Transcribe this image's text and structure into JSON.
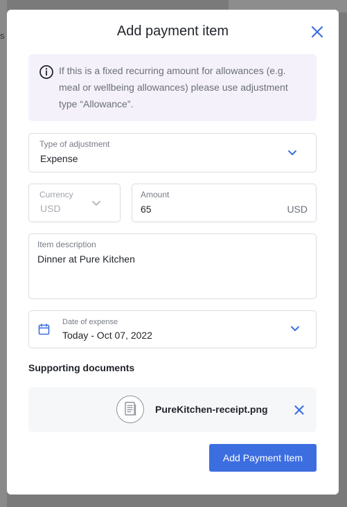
{
  "backdrop": {
    "fragment": "s l"
  },
  "modal": {
    "title": "Add payment item",
    "info": {
      "icon": "info-circle-icon",
      "text": "If this is a fixed recurring amount for allowances (e.g. meal or wellbeing allowances) please use adjustment type “Allowance”."
    },
    "type_of_adjustment": {
      "label": "Type of adjustment",
      "value": "Expense"
    },
    "currency": {
      "label": "Currency",
      "value": "USD"
    },
    "amount": {
      "label": "Amount",
      "value": "65",
      "unit": "USD"
    },
    "item_description": {
      "label": "Item description",
      "value": "Dinner at Pure Kitchen"
    },
    "date_of_expense": {
      "label": "Date of expense",
      "value": "Today - Oct 07, 2022"
    },
    "supporting_documents": {
      "title": "Supporting documents",
      "files": [
        {
          "name": "PureKitchen-receipt.png",
          "icon": "document-icon"
        }
      ]
    },
    "submit_label": "Add Payment Item"
  },
  "colors": {
    "accent": "#3d6ee0",
    "info_bg": "#f5f1fb",
    "file_bg": "#f6f7f9"
  }
}
